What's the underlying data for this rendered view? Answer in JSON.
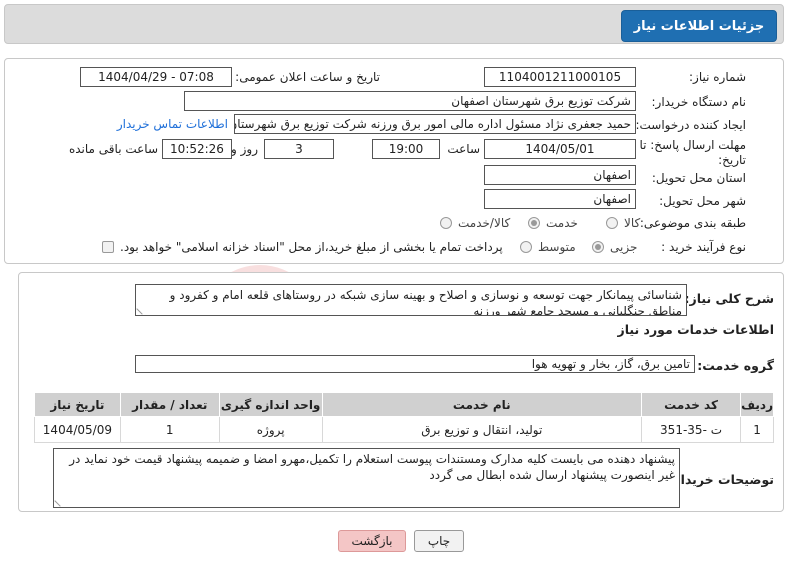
{
  "header": {
    "title": "جزئیات اطلاعات نیاز"
  },
  "fields": {
    "need_number_label": "شماره نیاز:",
    "need_number": "1104001211000105",
    "announce_label": "تاریخ و ساعت اعلان عمومی:",
    "announce_value": "1404/04/29 - 07:08",
    "buyer_org_label": "نام دستگاه خریدار:",
    "buyer_org": "شرکت توزیع برق شهرستان اصفهان",
    "requester_label": "ایجاد کننده درخواست:",
    "requester": "حمید جعفری نژاد مسئول اداره مالی امور برق ورزنه شرکت توزیع برق شهرستان",
    "contact_link": "اطلاعات تماس خریدار",
    "deadline_label": "مهلت ارسال پاسخ: تا تاریخ:",
    "deadline_date": "1404/05/01",
    "time_label": "ساعت",
    "deadline_time": "19:00",
    "days_value": "3",
    "days_label": "روز و",
    "remaining_time": "10:52:26",
    "remaining_label": "ساعت باقی مانده",
    "province_label": "استان محل تحویل:",
    "province": "اصفهان",
    "city_label": "شهر محل تحویل:",
    "city": "اصفهان",
    "category_label": "طبقه بندی موضوعی:",
    "category_options": [
      "کالا",
      "خدمت",
      "کالا/خدمت"
    ],
    "category_selected": "خدمت",
    "process_label": "نوع فرآیند خرید :",
    "process_options": [
      "جزیی",
      "متوسط"
    ],
    "process_selected": "جزیی",
    "payment_note": "پرداخت تمام یا بخشی از مبلغ خرید،از محل \"اسناد خزانه اسلامی\" خواهد بود."
  },
  "summary": {
    "label": "شرح کلی نیاز:",
    "text": "شناسائی پیمانکار جهت توسعه و نوسازی و اصلاح و بهینه سازی شبکه  در روستاهای قلعه امام و کفرود و مناطق جنگلبانی و مسجد جامع شهر ورزنه"
  },
  "services": {
    "section_title": "اطلاعات خدمات مورد نیاز",
    "group_label": "گروه خدمت:",
    "group_value": "تامین برق، گاز، بخار و تهویه هوا",
    "columns": [
      "ردیف",
      "کد خدمت",
      "نام خدمت",
      "واحد اندازه گیری",
      "تعداد / مقدار",
      "تاریخ نیاز"
    ],
    "rows": [
      [
        "1",
        "ت -35-351",
        "تولید، انتقال و توزیع برق",
        "پروژه",
        "1",
        "1404/05/09"
      ]
    ]
  },
  "buyer_notes": {
    "label": "توضیحات خریدار:",
    "text": "پیشنهاد دهنده می بایست کلیه مدارک ومستندات پیوست استعلام را تکمیل،مهرو امضا و ضمیمه پیشنهاد قیمت خود نماید در غیر اینصورت پیشنهاد ارسال شده ابطال می گردد"
  },
  "buttons": {
    "print": "چاپ",
    "back": "بازگشت"
  },
  "watermark": "AriaTender.net",
  "colors": {
    "header_button": "#1f6fb2",
    "link": "#1e6fd9",
    "back_button": "#f4c6c6"
  }
}
